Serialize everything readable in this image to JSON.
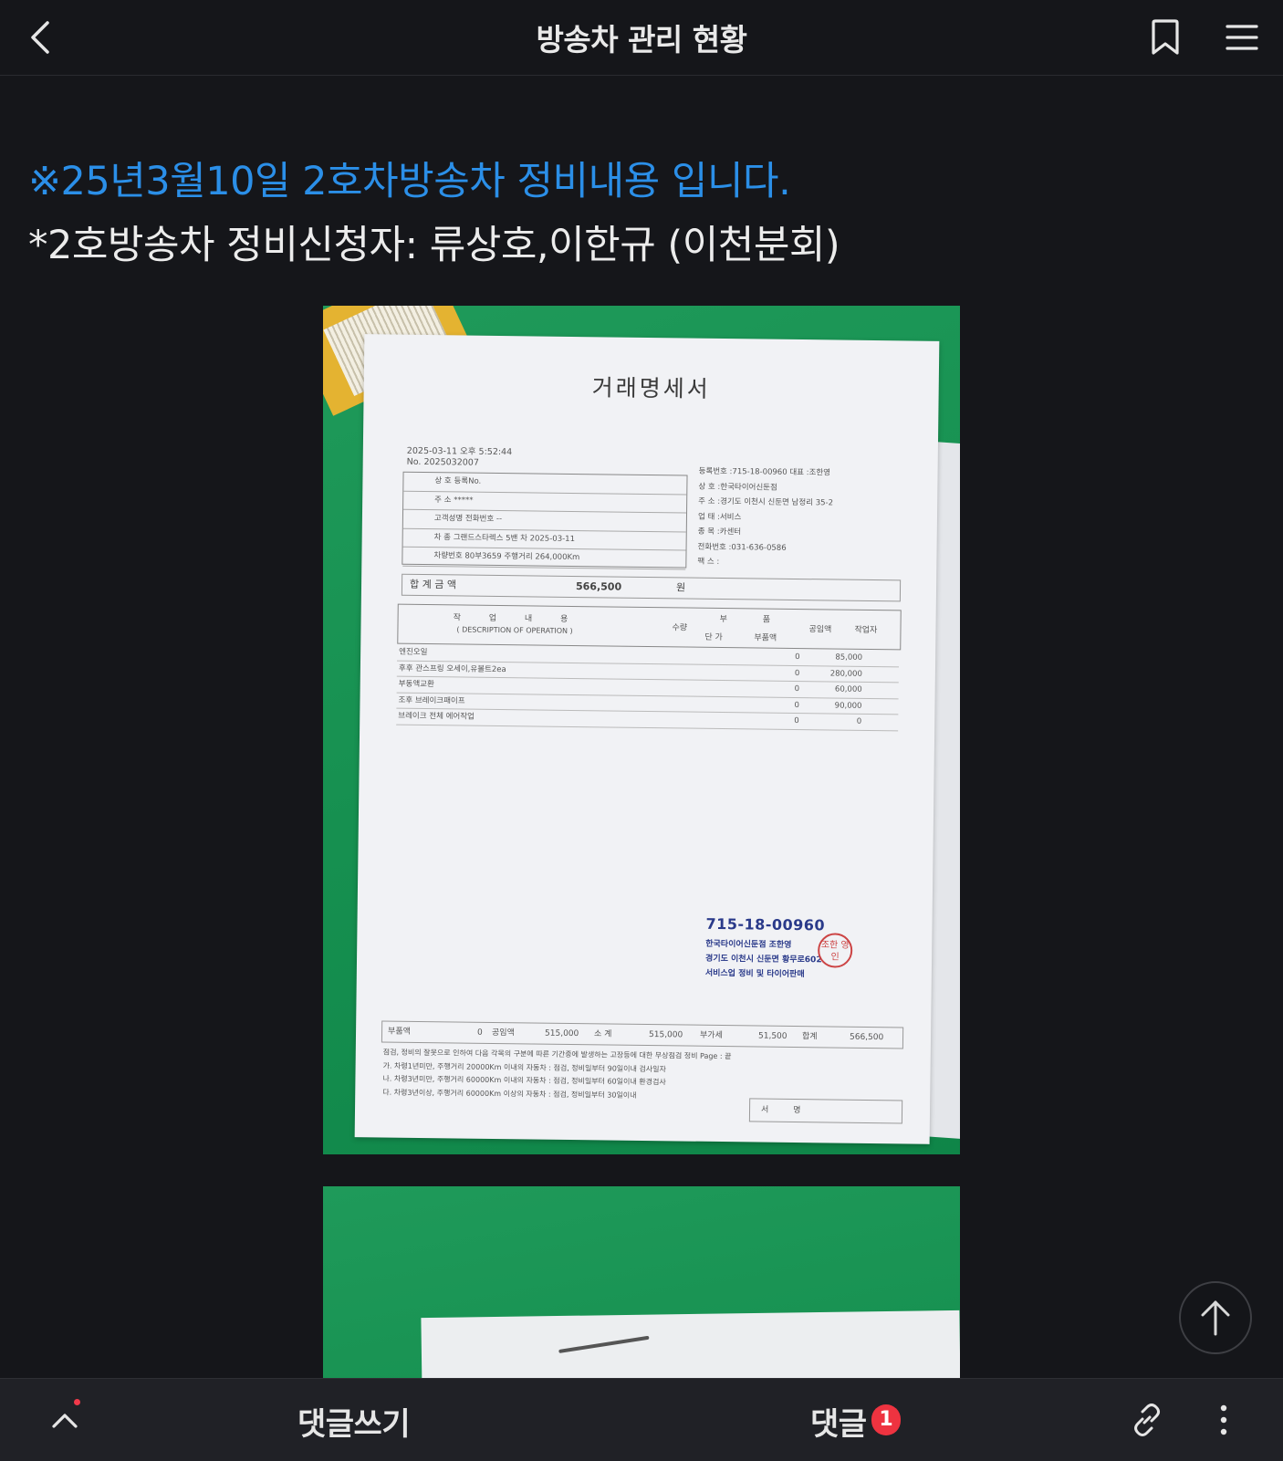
{
  "header": {
    "title": "방송차 관리 현황",
    "back_icon": "chevron-left-icon",
    "bookmark_icon": "bookmark-icon",
    "menu_icon": "hamburger-menu-icon"
  },
  "post": {
    "headline": "※25년3월10일 2호차방송차 정비내용 입니다.",
    "subline": "*2호방송차 정비신청자: 류상호,이한규 (이천분회)",
    "accent_color": "#2b8fe8"
  },
  "receipt": {
    "title": "거래명세서",
    "datetime": "2025-03-11 오후 5:52:44",
    "number": "No. 2025032007",
    "left_rows": [
      "상 호                                   등록No.",
      "주 소  *****",
      "고객성명                       전화번호  --",
      "차 종  그랜드스타렉스 5밴   차 2025-03-11",
      "차량번호  80부3659     주행거리  264,000Km"
    ],
    "right_rows": [
      "등록번호 :715-18-00960   대표 :조한영",
      "상    호 :한국타이어신둔점",
      "주    소 :경기도 이천시 신둔면 남정리 35-2",
      "업    태 :서비스",
      "종    목 :카센터",
      "전화번호 :031-636-0586",
      "팩    스 :"
    ],
    "total_label": "합 계 금 액",
    "total_amount": "566,500",
    "total_unit": "원",
    "ops_header": {
      "work": "작 업 내 용",
      "work_en": "( DESCRIPTION OF OPERATION )",
      "qty": "수량",
      "parts": "부 품",
      "unit_price": "단 가",
      "parts_amount": "부품액",
      "labor": "공임액",
      "worker": "작업자"
    },
    "line_items": [
      {
        "desc": "엔진오일",
        "qty": "0",
        "price": "85,000"
      },
      {
        "desc": "후후 관스프링 오세이,유볼트2ea",
        "qty": "0",
        "price": "280,000"
      },
      {
        "desc": "부동액교환",
        "qty": "0",
        "price": "60,000"
      },
      {
        "desc": "조후 브레이크패이프",
        "qty": "0",
        "price": "90,000"
      },
      {
        "desc": "브레이크 전체 에어작업",
        "qty": "0",
        "price": "0"
      }
    ],
    "stamp": {
      "reg_no": "715-18-00960",
      "line1": "한국타이어신둔점  조한영",
      "line2": "경기도 이천시 신둔면 황무로602",
      "line3": "서비스업   정비 및 타이어판매",
      "seal": "조한 영인"
    },
    "summary": {
      "parts_label": "부품액",
      "parts": "0",
      "labor_label": "공임액",
      "labor": "515,000",
      "subtotal_label": "소 계",
      "subtotal": "515,000",
      "vat_label": "부가세",
      "vat": "51,500",
      "sum_label": "합계",
      "sum": "566,500"
    },
    "notes": [
      "점검, 정비의 잘못으로 인하여 다음 각목의 구분에 따른 기간중에 발생하는 고장등에 대한 무상점검 정비   Page :  끝",
      "가.  차령1년미만, 주행거리  20000Km 이내의 자동차 : 점검, 정비일부터 90일이내               검사일자",
      "나.  차령3년미만, 주행거리  60000Km 이내의 자동차 : 점검, 정비일부터 60일이내               환경검사",
      "다.  차령3년이상, 주행거리  60000Km 이상의 자동차 : 점검, 정비일부터 30일이내"
    ],
    "sign_label": "서 명"
  },
  "scroll_top_icon": "arrow-up-icon",
  "bottom_bar": {
    "collapse_icon": "chevron-up-icon",
    "write_comment": "댓글쓰기",
    "comments": "댓글",
    "comment_count": "1",
    "link_icon": "link-icon",
    "more_icon": "more-vertical-icon",
    "badge_color": "#ee3340"
  }
}
